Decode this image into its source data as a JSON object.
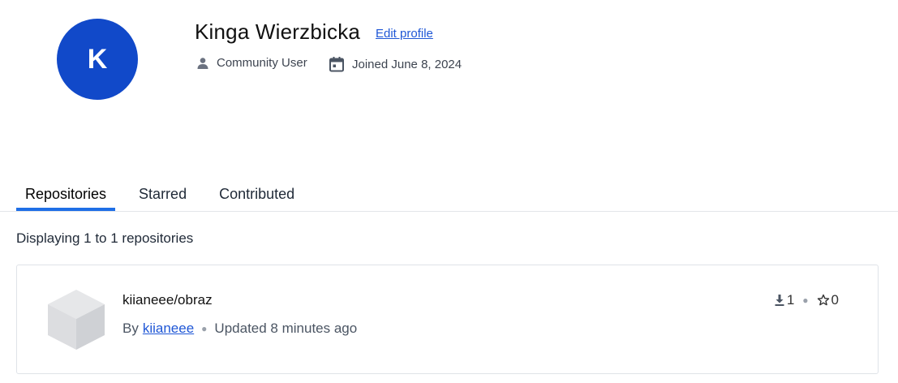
{
  "profile": {
    "avatar_initial": "K",
    "name": "Kinga Wierzbicka",
    "edit_label": "Edit profile",
    "role": "Community User",
    "joined": "Joined June 8, 2024"
  },
  "tabs": [
    {
      "label": "Repositories",
      "active": true
    },
    {
      "label": "Starred",
      "active": false
    },
    {
      "label": "Contributed",
      "active": false
    }
  ],
  "listing": {
    "count_text": "Displaying 1 to 1 repositories"
  },
  "repositories": [
    {
      "name": "kiianeee/obraz",
      "by_prefix": "By",
      "owner": "kiianeee",
      "updated": "Updated 8 minutes ago",
      "downloads": "1",
      "stars": "0"
    }
  ],
  "colors": {
    "avatar_bg": "#1149c9",
    "link": "#1f57d6",
    "tab_accent": "#1f6fe6"
  },
  "icons": {
    "role": "person-icon",
    "joined": "calendar-icon",
    "repo": "cube-icon",
    "downloads": "download-icon",
    "stars": "star-icon"
  }
}
